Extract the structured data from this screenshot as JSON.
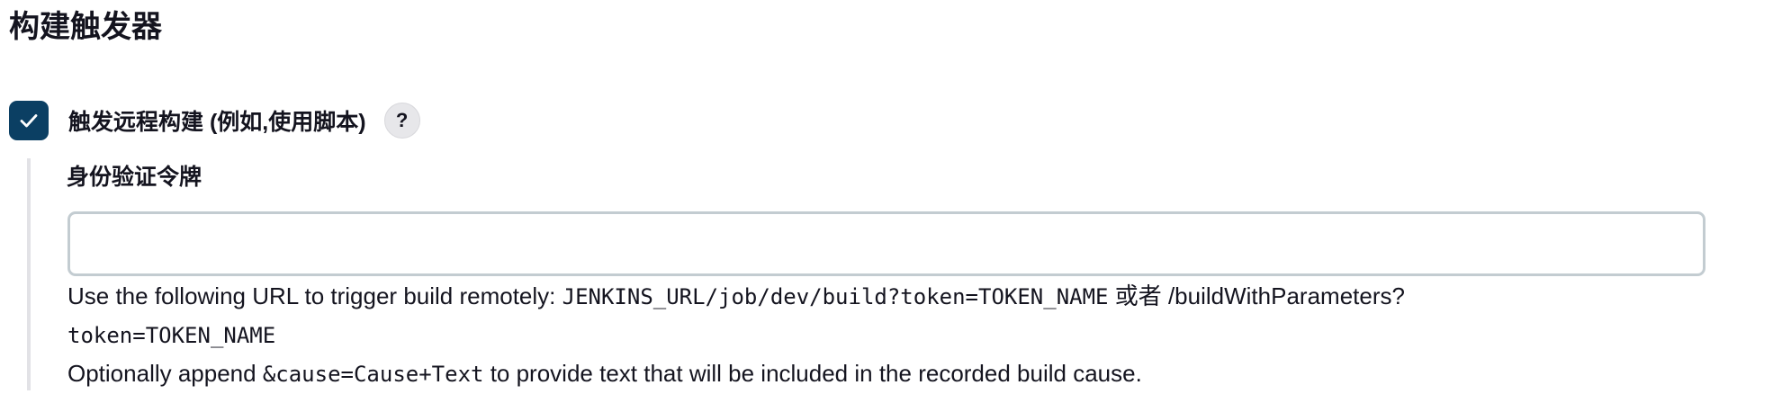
{
  "section": {
    "title": "构建触发器"
  },
  "trigger_remote": {
    "checked": true,
    "label": "触发远程构建 (例如,使用脚本)",
    "help_label": "?"
  },
  "token_field": {
    "label": "身份验证令牌",
    "value": "",
    "placeholder": ""
  },
  "help": {
    "line1_prefix": "Use the following URL to trigger build remotely: ",
    "url_build": "JENKINS_URL/job/dev/build?token=TOKEN_NAME",
    "or_text": " 或者 ",
    "url_params_path": "/buildWithParameters?",
    "url_params_token": "token=TOKEN_NAME",
    "line2_prefix": "Optionally append ",
    "cause_param": "&cause=Cause+Text",
    "line2_suffix": " to provide text that will be included in the recorded build cause."
  },
  "colors": {
    "checkbox_fill": "#0b3f63",
    "input_border": "#c3ccd1",
    "nested_rule": "#e2e2e6",
    "help_button_bg": "#e7e7ea"
  },
  "icons": {
    "checkmark": "check-icon",
    "help": "question-mark-icon"
  }
}
